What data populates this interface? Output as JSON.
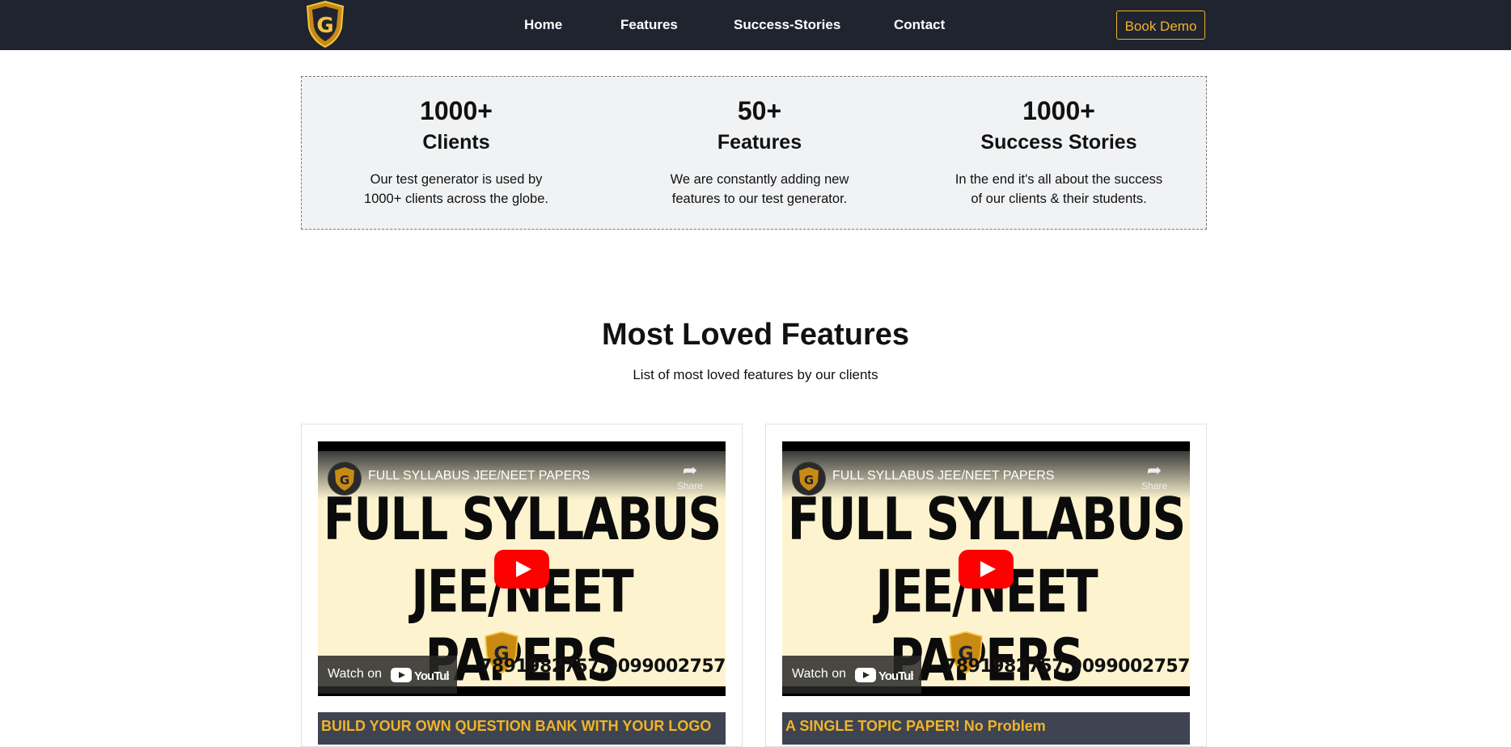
{
  "nav": {
    "logo_icon": "shield-g-logo",
    "links": [
      "Home",
      "Features",
      "Success-Stories",
      "Contact"
    ],
    "book_demo": "Book Demo",
    "colors": {
      "background": "#1f242e",
      "accent": "#f0b429"
    }
  },
  "stats": [
    {
      "number": "1000+",
      "label": "Clients",
      "desc": "Our test generator is used by 1000+ clients across the globe."
    },
    {
      "number": "50+",
      "label": "Features",
      "desc": "We are constantly adding new features to our test generator."
    },
    {
      "number": "1000+",
      "label": "Success Stories",
      "desc": "In the end it's all about the success of our clients & their students."
    }
  ],
  "features_section": {
    "title": "Most Loved Features",
    "subtitle": "List of most loved features by our clients"
  },
  "videos": [
    {
      "title": "FULL SYLLABUS JEE/NEET PAPERS",
      "line1": "FULL SYLLABUS",
      "line2": "JEE/NEET PAPERS",
      "share": "Share",
      "watch_on": "Watch on",
      "youtube": "YouTube",
      "phone": "7891982757,9099002757",
      "caption": "BUILD YOUR OWN QUESTION BANK WITH YOUR LOGO"
    },
    {
      "title": "FULL SYLLABUS JEE/NEET PAPERS",
      "line1": "FULL SYLLABUS",
      "line2": "JEE/NEET PAPERS",
      "share": "Share",
      "watch_on": "Watch on",
      "youtube": "YouTube",
      "phone": "7891982757,9099002757",
      "caption": "A SINGLE TOPIC PAPER! No Problem"
    }
  ]
}
